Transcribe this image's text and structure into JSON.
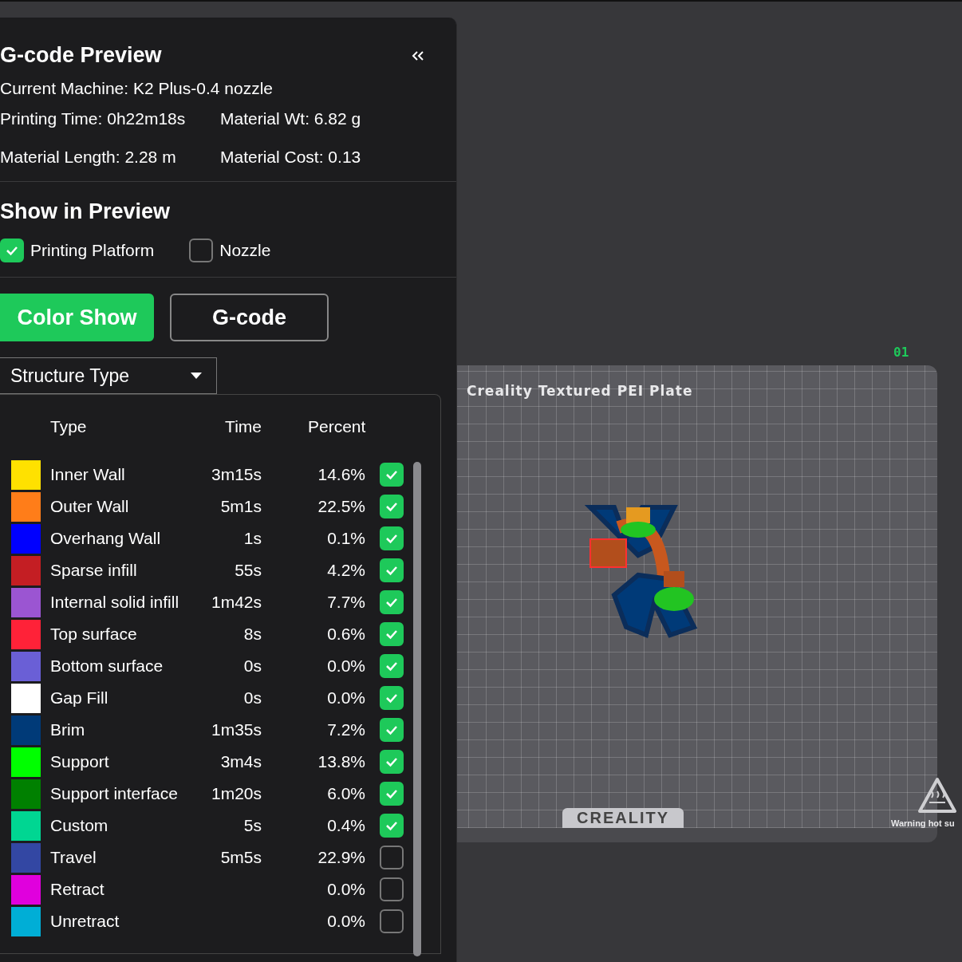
{
  "panel": {
    "title": "G-code Preview",
    "machine": "Current Machine: K2 Plus-0.4 nozzle",
    "stats": [
      {
        "label": "Printing Time: 0h22m18s"
      },
      {
        "label": "Material Wt: 6.82 g"
      },
      {
        "label": "Material Length: 2.28 m"
      },
      {
        "label": "Material Cost: 0.13"
      }
    ]
  },
  "show_in_preview": {
    "title": "Show in Preview",
    "options": [
      {
        "label": "Printing Platform",
        "checked": true
      },
      {
        "label": "Nozzle",
        "checked": false
      }
    ]
  },
  "view_tabs": [
    {
      "label": "Color Show",
      "selected": true
    },
    {
      "label": "G-code",
      "selected": false
    }
  ],
  "dropdown": {
    "value": "Structure Type"
  },
  "table": {
    "columns": [
      "Type",
      "Time",
      "Percent"
    ],
    "rows": [
      {
        "name": "Inner Wall",
        "time": "3m15s",
        "percent": "14.6%",
        "color": "#ffe100",
        "checked": true
      },
      {
        "name": "Outer Wall",
        "time": "5m1s",
        "percent": "22.5%",
        "color": "#ff7d19",
        "checked": true
      },
      {
        "name": "Overhang Wall",
        "time": "1s",
        "percent": "0.1%",
        "color": "#0000ff",
        "checked": true
      },
      {
        "name": "Sparse infill",
        "time": "55s",
        "percent": "4.2%",
        "color": "#c41e23",
        "checked": true
      },
      {
        "name": "Internal solid infill",
        "time": "1m42s",
        "percent": "7.7%",
        "color": "#9b55d2",
        "checked": true
      },
      {
        "name": "Top surface",
        "time": "8s",
        "percent": "0.6%",
        "color": "#ff2238",
        "checked": true
      },
      {
        "name": "Bottom surface",
        "time": "0s",
        "percent": "0.0%",
        "color": "#6a5fd6",
        "checked": true
      },
      {
        "name": "Gap Fill",
        "time": "0s",
        "percent": "0.0%",
        "color": "#ffffff",
        "checked": true
      },
      {
        "name": "Brim",
        "time": "1m35s",
        "percent": "7.2%",
        "color": "#003a78",
        "checked": true
      },
      {
        "name": "Support",
        "time": "3m4s",
        "percent": "13.8%",
        "color": "#00ff00",
        "checked": true
      },
      {
        "name": "Support interface",
        "time": "1m20s",
        "percent": "6.0%",
        "color": "#008000",
        "checked": true
      },
      {
        "name": "Custom",
        "time": "5s",
        "percent": "0.4%",
        "color": "#00d692",
        "checked": true
      },
      {
        "name": "Travel",
        "time": "5m5s",
        "percent": "22.9%",
        "color": "#3347a3",
        "checked": false
      },
      {
        "name": "Retract",
        "time": "",
        "percent": "0.0%",
        "color": "#e000dd",
        "checked": false
      },
      {
        "name": "Unretract",
        "time": "",
        "percent": "0.0%",
        "color": "#00aed6",
        "checked": false
      }
    ]
  },
  "viewport": {
    "plate_number": "01",
    "plate_name": "Creality Textured PEI Plate",
    "brand": "CREALITY",
    "warning": "Warning hot su"
  }
}
